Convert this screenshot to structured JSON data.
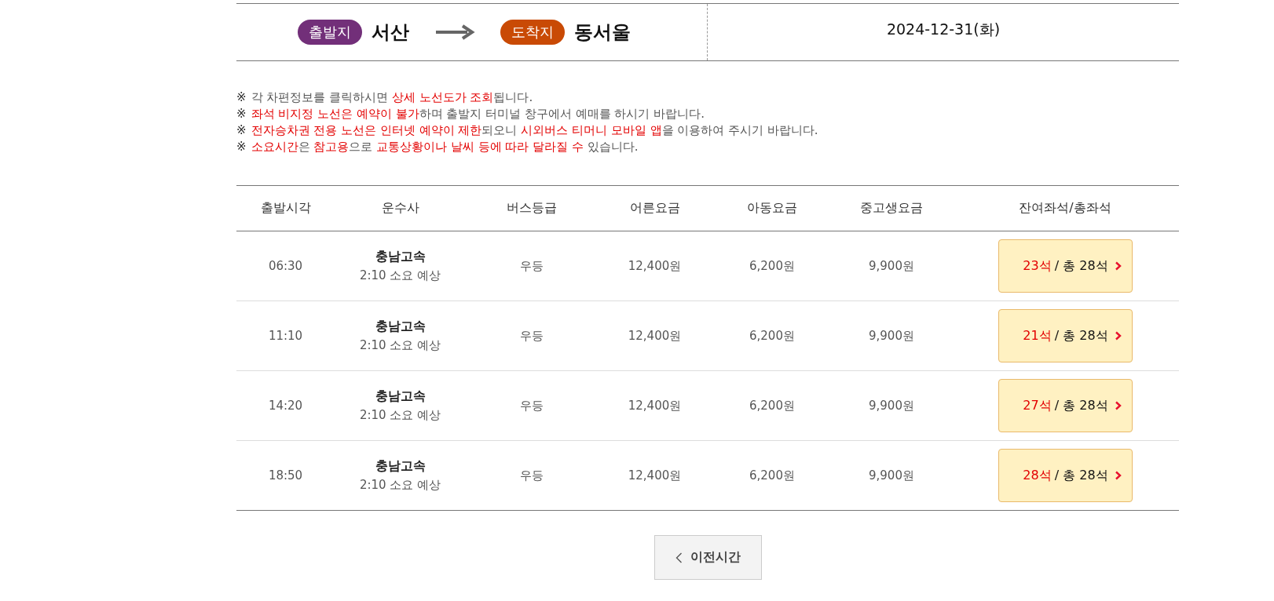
{
  "route": {
    "departure_label": "출발지",
    "departure": "서산",
    "arrival_label": "도착지",
    "arrival": "동서울",
    "date": "2024-12-31(화)"
  },
  "notes": [
    {
      "mark": "※",
      "segments": [
        {
          "text": "각 차편정보를 클릭하시면 ",
          "highlight": false
        },
        {
          "text": "상세 노선도가 조회",
          "highlight": true
        },
        {
          "text": "됩니다.",
          "highlight": false
        }
      ]
    },
    {
      "mark": "※",
      "segments": [
        {
          "text": "좌석 비지정 노선은 예약이 불가",
          "highlight": true
        },
        {
          "text": "하며 출발지 터미널 창구에서 예매를 하시기 바랍니다.",
          "highlight": false
        }
      ]
    },
    {
      "mark": "※",
      "segments": [
        {
          "text": "전자승차권 전용 노선은 인터넷 예약이 제한",
          "highlight": true
        },
        {
          "text": "되오니 ",
          "highlight": false
        },
        {
          "text": "시외버스 티머니 모바일 앱",
          "highlight": true
        },
        {
          "text": "을 이용하여 주시기 바랍니다.",
          "highlight": false
        }
      ]
    },
    {
      "mark": "※",
      "segments": [
        {
          "text": "소요시간",
          "highlight": true
        },
        {
          "text": "은 ",
          "highlight": false
        },
        {
          "text": "참고용",
          "highlight": true
        },
        {
          "text": "으로 ",
          "highlight": false
        },
        {
          "text": "교통상황이나 날씨 등에 따라 달라질 수",
          "highlight": true
        },
        {
          "text": " 있습니다.",
          "highlight": false
        }
      ]
    }
  ],
  "table": {
    "columns": [
      "출발시각",
      "운수사",
      "버스등급",
      "어른요금",
      "아동요금",
      "중고생요금",
      "잔여좌석/총좌석"
    ],
    "rows": [
      {
        "time": "06:30",
        "company": "충남고속",
        "duration": "2:10 소요 예상",
        "grade": "우등",
        "adult": "12,400원",
        "child": "6,200원",
        "student": "9,900원",
        "remaining": "23석",
        "total": "/ 총 28석"
      },
      {
        "time": "11:10",
        "company": "충남고속",
        "duration": "2:10 소요 예상",
        "grade": "우등",
        "adult": "12,400원",
        "child": "6,200원",
        "student": "9,900원",
        "remaining": "21석",
        "total": "/ 총 28석"
      },
      {
        "time": "14:20",
        "company": "충남고속",
        "duration": "2:10 소요 예상",
        "grade": "우등",
        "adult": "12,400원",
        "child": "6,200원",
        "student": "9,900원",
        "remaining": "27석",
        "total": "/ 총 28석"
      },
      {
        "time": "18:50",
        "company": "충남고속",
        "duration": "2:10 소요 예상",
        "grade": "우등",
        "adult": "12,400원",
        "child": "6,200원",
        "student": "9,900원",
        "remaining": "28석",
        "total": "/ 총 28석"
      }
    ]
  },
  "prev_button": "이전시간"
}
